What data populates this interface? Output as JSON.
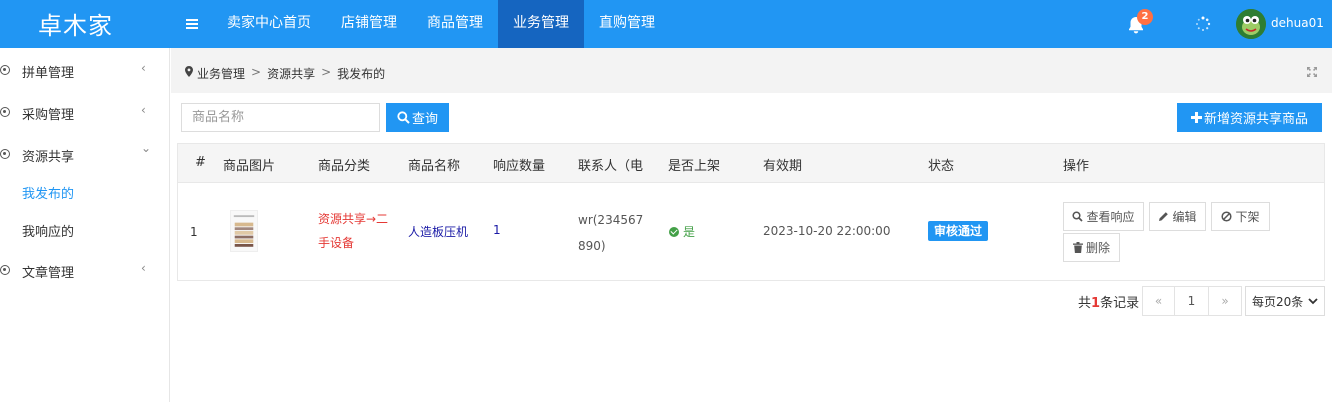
{
  "app": {
    "logo": "卓木家"
  },
  "nav": {
    "items": [
      {
        "label": "卖家中心首页"
      },
      {
        "label": "店铺管理"
      },
      {
        "label": "商品管理"
      },
      {
        "label": "业务管理",
        "active": true
      },
      {
        "label": "直购管理"
      }
    ]
  },
  "header": {
    "notification_count": "2",
    "username": "dehua01"
  },
  "sidebar": {
    "groups": [
      {
        "label": "拼单管理",
        "arrow": "‹"
      },
      {
        "label": "采购管理",
        "arrow": "‹"
      },
      {
        "label": "资源共享",
        "arrow": "⌄"
      },
      {
        "label": "文章管理",
        "arrow": "‹"
      }
    ],
    "sub_items": [
      {
        "label": "我发布的",
        "active": true
      },
      {
        "label": "我响应的"
      }
    ]
  },
  "breadcrumb": {
    "items": [
      "业务管理",
      "资源共享",
      "我发布的"
    ],
    "separator": ">"
  },
  "toolbar": {
    "search_placeholder": "商品名称",
    "search_label": "查询",
    "add_label": "新增资源共享商品"
  },
  "table": {
    "headers": [
      "#",
      "商品图片",
      "商品分类",
      "商品名称",
      "响应数量",
      "联系人（电",
      "是否上架",
      "有效期",
      "状态",
      "操作"
    ],
    "rows": [
      {
        "index": "1",
        "category": "资源共享→二手设备",
        "name": "人造板压机",
        "responses": "1",
        "contact": "wr(234567890)",
        "on_sale": "是",
        "expiry": "2023-10-20 22:00:00",
        "status": "审核通过",
        "actions": {
          "view": "查看响应",
          "edit": "编辑",
          "offline": "下架",
          "delete": "删除"
        }
      }
    ]
  },
  "pagination": {
    "total_prefix": "共",
    "total_count": "1",
    "total_suffix": "条记录",
    "prev": "«",
    "current": "1",
    "next": "»",
    "page_size": "每页20条"
  },
  "colors": {
    "primary": "#2196f3",
    "nav_active": "#1565c0",
    "category_red": "#e53935",
    "success_green": "#43a047",
    "badge_orange": "#ff7043"
  }
}
